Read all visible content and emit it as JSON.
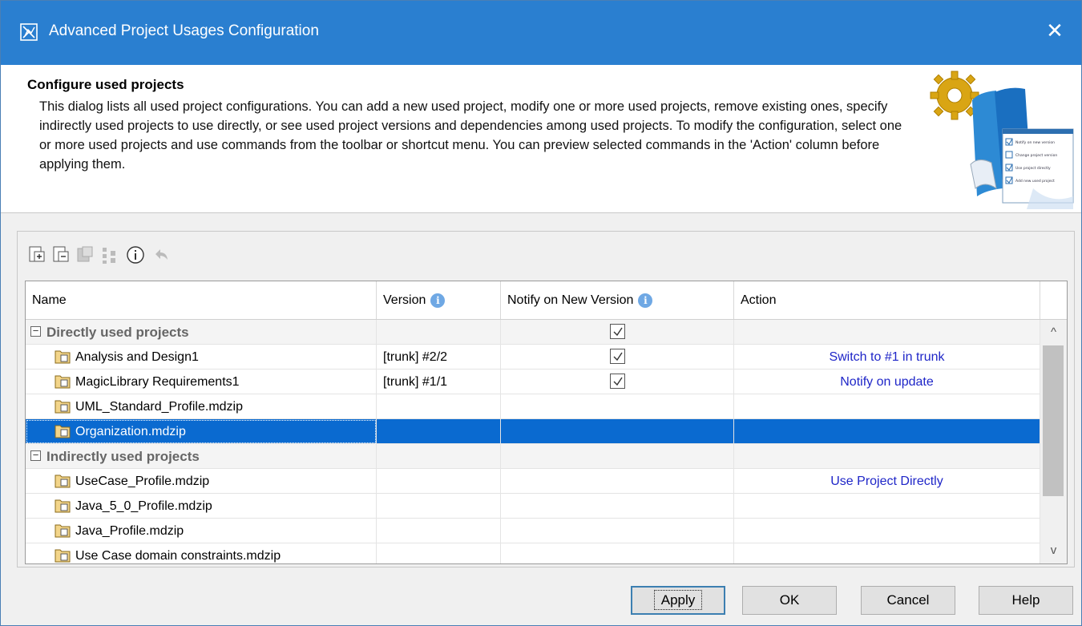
{
  "window": {
    "title": "Advanced Project Usages Configuration",
    "close_glyph": "✕"
  },
  "header": {
    "heading": "Configure used projects",
    "description": "This dialog lists all used project configurations. You can add a new used project, modify one or more used projects, remove existing ones, specify indirectly used projects to use directly, or see used project versions and dependencies among used projects. To modify the configuration, select one or more used projects and use commands from the toolbar or shortcut menu. You can preview selected commands in the 'Action' column before applying them.",
    "hero_checklist": [
      "Notify on new version",
      "Change project version",
      "Use project directly",
      "Add new used project"
    ]
  },
  "toolbar": {
    "buttons": [
      {
        "icon": "add-project-icon",
        "enabled": true
      },
      {
        "icon": "remove-project-icon",
        "enabled": true
      },
      {
        "icon": "change-version-icon",
        "enabled": false
      },
      {
        "icon": "dependencies-icon",
        "enabled": false
      },
      {
        "icon": "info-icon",
        "enabled": true
      },
      {
        "icon": "undo-icon",
        "enabled": false
      }
    ]
  },
  "table": {
    "columns": {
      "name": "Name",
      "version": "Version",
      "notify": "Notify on New Version",
      "action": "Action"
    },
    "info_glyph": "i",
    "groups": [
      {
        "label": "Directly used projects",
        "expander": "−",
        "notify_checked": true
      },
      {
        "label": "Indirectly used projects",
        "expander": "−",
        "notify_checked": false
      }
    ],
    "rows": [
      {
        "name": "Analysis and Design1",
        "version": "[trunk] #2/2",
        "notify": true,
        "action": "Switch to #1 in trunk"
      },
      {
        "name": "MagicLibrary Requirements1",
        "version": "[trunk] #1/1",
        "notify": true,
        "action": "Notify on update"
      },
      {
        "name": "UML_Standard_Profile.mdzip",
        "version": "",
        "notify": false,
        "action": ""
      },
      {
        "name": "Organization.mdzip",
        "version": "",
        "notify": false,
        "action": "",
        "selected": true
      },
      {
        "name": "UseCase_Profile.mdzip",
        "version": "",
        "notify": false,
        "action": "Use Project Directly"
      },
      {
        "name": "Java_5_0_Profile.mdzip",
        "version": "",
        "notify": false,
        "action": ""
      },
      {
        "name": "Java_Profile.mdzip",
        "version": "",
        "notify": false,
        "action": ""
      },
      {
        "name": "Use Case domain constraints.mdzip",
        "version": "",
        "notify": false,
        "action": ""
      }
    ],
    "scroll_up_glyph": "^",
    "scroll_down_glyph": "v"
  },
  "buttons": {
    "apply": "Apply",
    "ok": "OK",
    "cancel": "Cancel",
    "help": "Help"
  },
  "colors": {
    "titlebar": "#2a7fd0",
    "selection": "#0a6ad0",
    "action_text": "#1f26c8"
  }
}
